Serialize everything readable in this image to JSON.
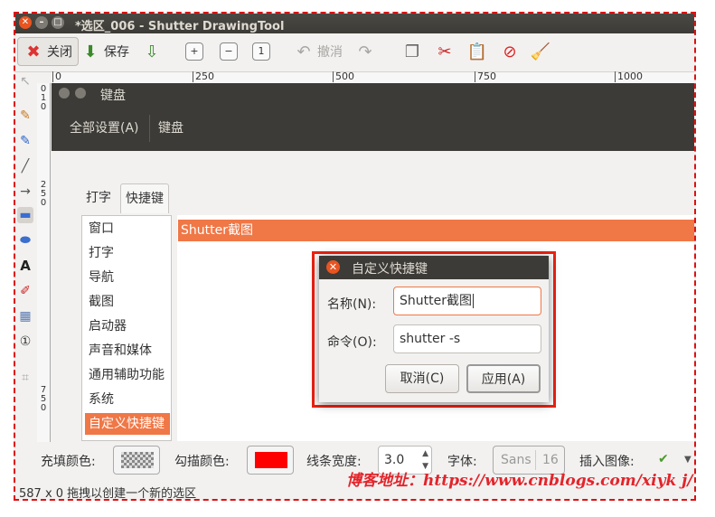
{
  "window": {
    "title": "*选区_006 - Shutter DrawingTool"
  },
  "toolbar": {
    "close_label": "关闭",
    "save_label": "保存",
    "undo_label": "撤消"
  },
  "ruler": {
    "h_ticks": [
      "0",
      "250",
      "500",
      "750",
      "1000"
    ],
    "v_ticks_a": [
      "0",
      "1",
      "0"
    ],
    "v_ticks_b": [
      "2",
      "5",
      "0"
    ],
    "v_ticks_c": [
      "7",
      "5",
      "0"
    ]
  },
  "keyboard": {
    "title": "键盘",
    "toolbar_items": [
      "全部设置(A)",
      "键盘"
    ],
    "tabs": [
      "打字",
      "快捷键"
    ],
    "categories": [
      "窗口",
      "打字",
      "导航",
      "截图",
      "启动器",
      "声音和媒体",
      "通用辅助功能",
      "系统",
      "自定义快捷键"
    ],
    "selected_category": "自定义快捷键",
    "shortcut_row": "Shutter截图"
  },
  "dialog": {
    "title": "自定义快捷键",
    "name_label": "名称(N):",
    "name_value": "Shutter截图",
    "command_label": "命令(O):",
    "command_value": "shutter -s",
    "cancel_label": "取消(C)",
    "apply_label": "应用(A)"
  },
  "bottom": {
    "fill_color_label": "充填颜色:",
    "stroke_color_label": "勾描颜色:",
    "stroke_color": "#ff0000",
    "line_width_label": "线条宽度:",
    "line_width_value": "3.0",
    "font_label": "字体:",
    "font_name": "Sans",
    "font_size": "16",
    "insert_image_label": "插入图像:"
  },
  "status": {
    "text": "587 x 0 拖拽以创建一个新的选区"
  },
  "watermark": {
    "text": "博客地址：https://www.cnblogs.com/xiyk j/"
  }
}
